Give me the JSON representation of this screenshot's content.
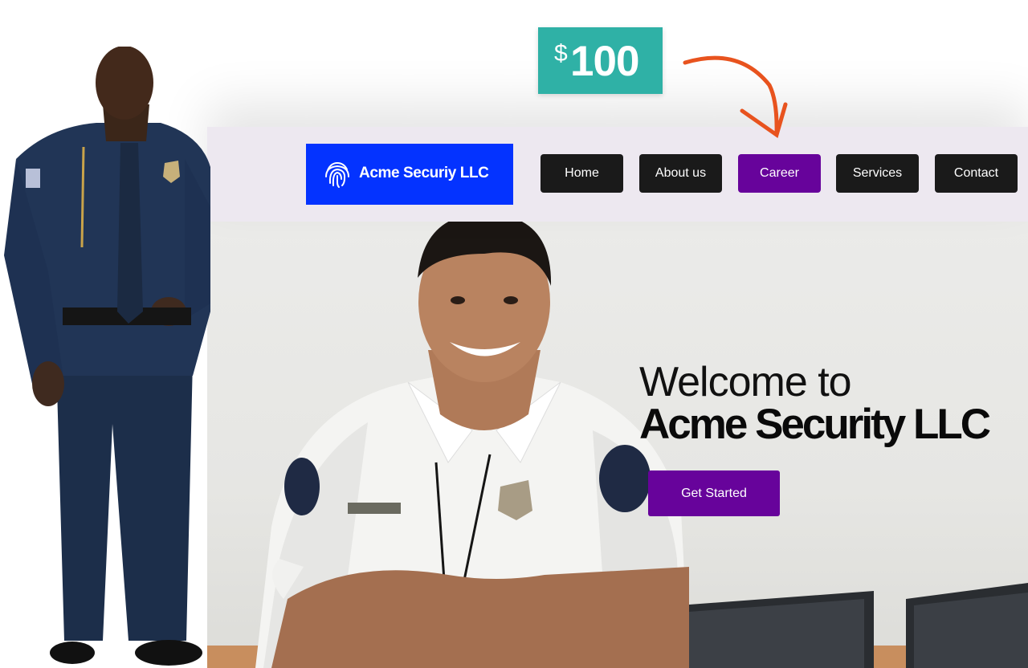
{
  "price_badge": {
    "currency": "$",
    "amount": "100"
  },
  "header": {
    "brand": "Acme Securiy LLC",
    "nav": [
      {
        "label": "Home",
        "active": false
      },
      {
        "label": "About us",
        "active": false
      },
      {
        "label": "Career",
        "active": true
      },
      {
        "label": "Services",
        "active": false
      },
      {
        "label": "Contact",
        "active": false
      }
    ]
  },
  "hero": {
    "welcome": "Welcome to",
    "company": "Acme Security LLC",
    "cta_label": "Get Started"
  },
  "colors": {
    "brand_blue": "#0433ff",
    "accent_purple": "#67039b",
    "badge_teal": "#2fb1a6",
    "arrow_orange": "#e8531e",
    "nav_bg": "#ede8f0",
    "button_dark": "#1a1a1a"
  },
  "icons": {
    "logo": "fingerprint-icon",
    "pointer": "curved-arrow-icon"
  },
  "images": {
    "left": "uniformed-guard-photo",
    "hero": "smiling-security-guard-photo"
  }
}
